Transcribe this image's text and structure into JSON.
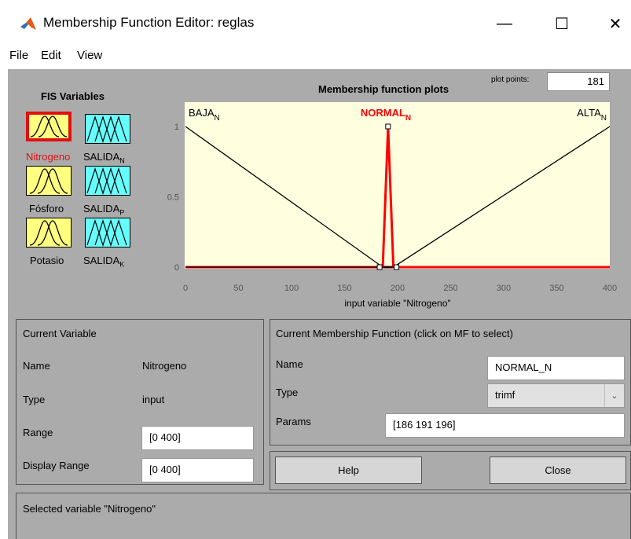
{
  "window": {
    "title": "Membership Function Editor: reglas",
    "controls": [
      "—",
      "☐",
      "✕"
    ]
  },
  "menu": [
    "File",
    "Edit",
    "View"
  ],
  "fis_variables": {
    "title": "FIS Variables",
    "inputs": [
      {
        "name": "Nitrogeno",
        "selected": true
      },
      {
        "name": "Fósforo",
        "selected": false
      },
      {
        "name": "Potasio",
        "selected": false
      }
    ],
    "outputs": [
      {
        "base": "SALIDA",
        "sub": "N"
      },
      {
        "base": "SALIDA",
        "sub": "P"
      },
      {
        "base": "SALIDA",
        "sub": "K"
      }
    ]
  },
  "plot": {
    "title": "Membership function plots",
    "plot_points_label": "plot points:",
    "plot_points": "181",
    "xlabel": "input variable \"Nitrogeno\"",
    "x_ticks": [
      "0",
      "50",
      "100",
      "150",
      "200",
      "250",
      "300",
      "350",
      "400"
    ],
    "y_ticks": [
      "0",
      "0.5",
      "1"
    ],
    "mf_labels": [
      {
        "base": "BAJA",
        "sub": "N"
      },
      {
        "base": "NORMAL",
        "sub": "N"
      },
      {
        "base": "ALTA",
        "sub": "N"
      }
    ],
    "colors": {
      "background": "#ffffe0",
      "selected": "#ff0000",
      "normal": "#000000",
      "axis_red": "#800000"
    }
  },
  "chart_data": {
    "type": "line",
    "xlim": [
      0,
      400
    ],
    "ylim": [
      0,
      1
    ],
    "series": [
      {
        "name": "BAJA_N",
        "x": [
          0,
          186,
          400
        ],
        "y": [
          1,
          0,
          0
        ]
      },
      {
        "name": "NORMAL_N",
        "x": [
          0,
          186,
          191,
          196,
          400
        ],
        "y": [
          0,
          0,
          1,
          0,
          0
        ]
      },
      {
        "name": "ALTA_N",
        "x": [
          0,
          196,
          400
        ],
        "y": [
          0,
          0,
          1
        ]
      }
    ]
  },
  "current_variable": {
    "title": "Current Variable",
    "name_label": "Name",
    "name_value": "Nitrogeno",
    "type_label": "Type",
    "type_value": "input",
    "range_label": "Range",
    "range_value": "[0 400]",
    "display_range_label": "Display Range",
    "display_range_value": "[0 400]"
  },
  "current_mf": {
    "title": "Current Membership Function (click on MF to select)",
    "name_label": "Name",
    "name_value": "NORMAL_N",
    "type_label": "Type",
    "type_value": "trimf",
    "params_label": "Params",
    "params_value": "[186 191 196]"
  },
  "buttons": {
    "help": "Help",
    "close": "Close"
  },
  "status": "Selected variable \"Nitrogeno\""
}
